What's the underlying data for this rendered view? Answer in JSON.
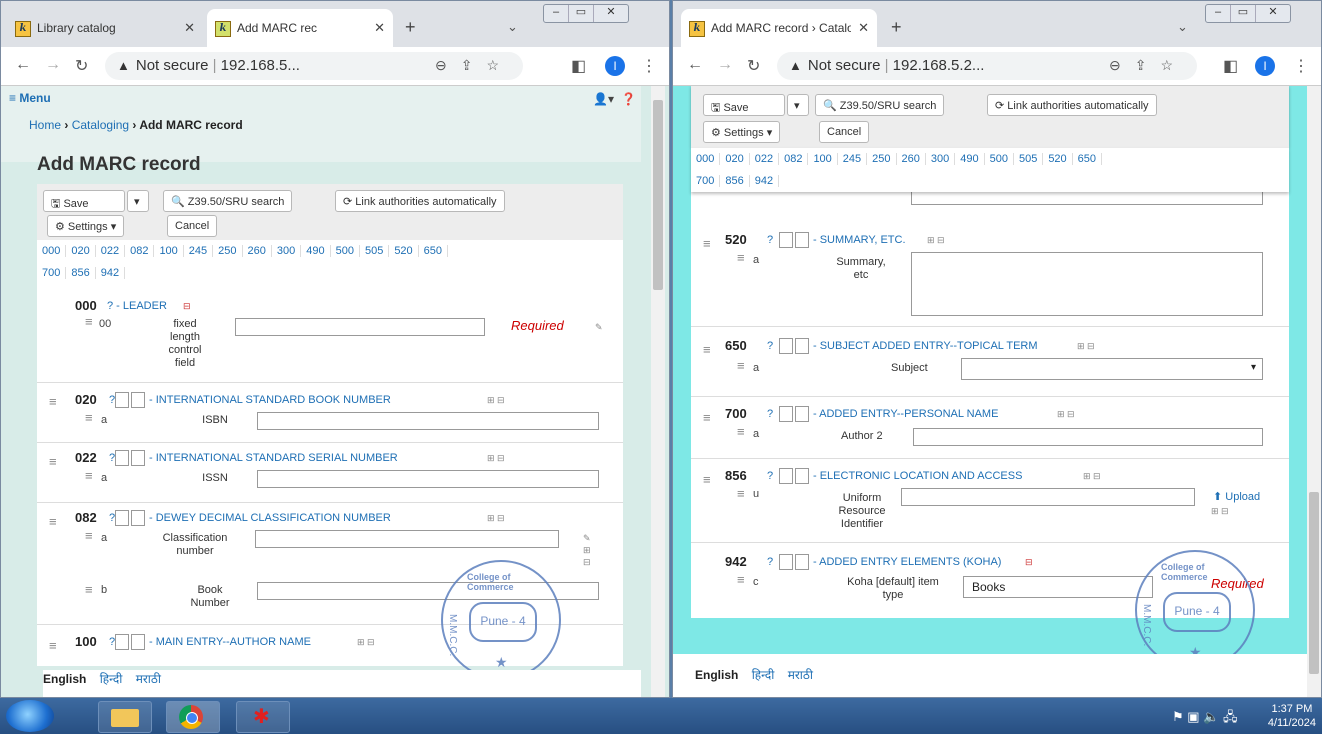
{
  "left": {
    "tabs": [
      {
        "label": "Library catalog"
      },
      {
        "label": "Add MARC rec"
      }
    ],
    "address": {
      "security": "Not secure",
      "url": "192.168.5..."
    },
    "profile_initial": "I",
    "menu_label": "≡ Menu",
    "breadcrumb": {
      "home": "Home",
      "cataloging": "Cataloging",
      "current": "Add MARC record"
    },
    "title": "Add MARC record",
    "buttons": {
      "save": "Save",
      "z3950": "Z39.50/SRU search",
      "link": "Link authorities automatically",
      "settings": "Settings",
      "cancel": "Cancel"
    },
    "tag_tabs": [
      "000",
      "020",
      "022",
      "082",
      "100",
      "245",
      "250",
      "260",
      "300",
      "490",
      "500",
      "505",
      "520",
      "650",
      "700",
      "856",
      "942"
    ],
    "fields": [
      {
        "tag": "000",
        "desc": "? - LEADER",
        "sub": "00",
        "label": "fixed\nlength\ncontrol\nfield",
        "required": "Required"
      },
      {
        "tag": "020",
        "q": "?",
        "desc": "- INTERNATIONAL STANDARD BOOK NUMBER",
        "sub": "a",
        "label": "ISBN"
      },
      {
        "tag": "022",
        "q": "?",
        "desc": "- INTERNATIONAL STANDARD SERIAL NUMBER",
        "sub": "a",
        "label": "ISSN"
      },
      {
        "tag": "082",
        "q": "?",
        "desc": "- DEWEY DECIMAL CLASSIFICATION NUMBER",
        "sub": "a",
        "label": "Classification\nnumber",
        "sub2": "b",
        "label2": "Book\nNumber"
      },
      {
        "tag": "100",
        "q": "?",
        "desc": "- MAIN ENTRY--AUTHOR NAME"
      }
    ],
    "footer": {
      "english": "English",
      "hindi": "हिन्दी",
      "marathi": "मराठी"
    }
  },
  "right": {
    "tabs": [
      {
        "label": "Add MARC record › Cataloging ›"
      }
    ],
    "address": {
      "security": "Not secure",
      "url": "192.168.5.2..."
    },
    "profile_initial": "I",
    "buttons": {
      "save": "Save",
      "z3950": "Z39.50/SRU search",
      "link": "Link authorities automatically",
      "settings": "Settings",
      "cancel": "Cancel"
    },
    "tag_tabs": [
      "000",
      "020",
      "022",
      "082",
      "100",
      "245",
      "250",
      "260",
      "300",
      "490",
      "500",
      "505",
      "520",
      "650",
      "700",
      "856",
      "942"
    ],
    "fields": [
      {
        "tag": "520",
        "q": "?",
        "desc": "- SUMMARY, ETC.",
        "sub": "a",
        "label": "Summary,\netc"
      },
      {
        "tag": "650",
        "q": "?",
        "desc": "- SUBJECT ADDED ENTRY--TOPICAL TERM",
        "sub": "a",
        "label": "Subject"
      },
      {
        "tag": "700",
        "q": "?",
        "desc": "- ADDED ENTRY--PERSONAL NAME",
        "sub": "a",
        "label": "Author 2"
      },
      {
        "tag": "856",
        "q": "?",
        "desc": "- ELECTRONIC LOCATION AND ACCESS",
        "sub": "u",
        "label": "Uniform\nResource\nIdentifier",
        "upload": "Upload"
      },
      {
        "tag": "942",
        "q": "?",
        "desc": "- ADDED ENTRY ELEMENTS (KOHA)",
        "sub": "c",
        "label": "Koha [default] item\ntype",
        "value": "Books",
        "required": "Required"
      }
    ],
    "footer": {
      "english": "English",
      "hindi": "हिन्दी",
      "marathi": "मराठी"
    }
  },
  "seal": {
    "text": "College of Commerce",
    "mark": "M.M.C.C.",
    "city": "Pune - 4"
  },
  "taskbar": {
    "time": "1:37 PM",
    "date": "4/11/2024"
  },
  "colors": {
    "link": "#1e6fb4",
    "required": "#cc0000",
    "page_bg_right": "#7ee8e6",
    "taskbar": "#2d5a92"
  }
}
